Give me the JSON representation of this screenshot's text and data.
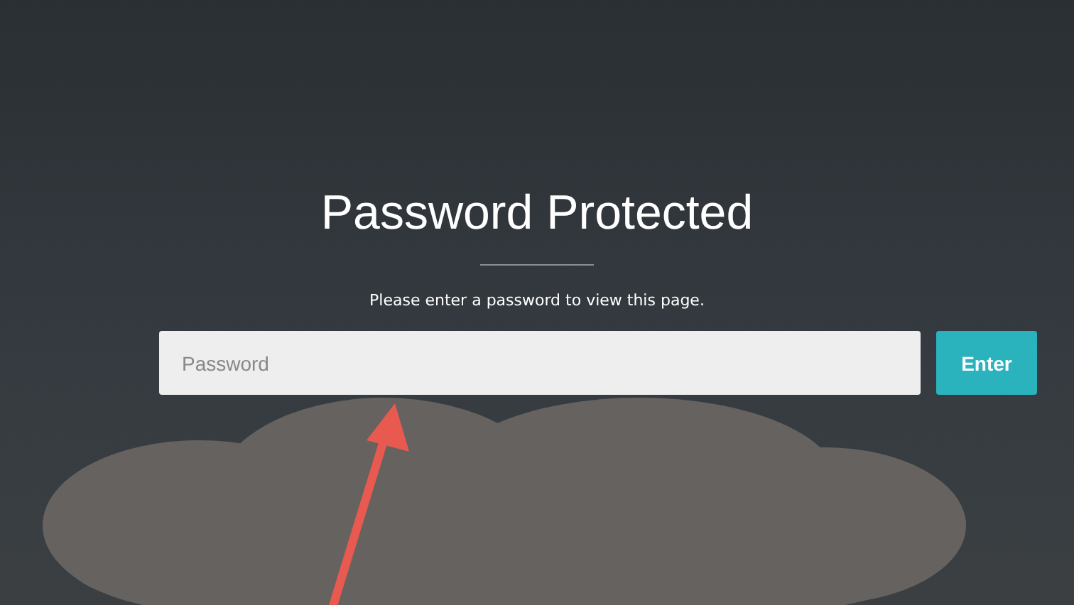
{
  "title": "Password Protected",
  "subtitle": "Please enter a password to view this page.",
  "password_field": {
    "placeholder": "Password"
  },
  "submit_button": {
    "label": "Enter"
  }
}
